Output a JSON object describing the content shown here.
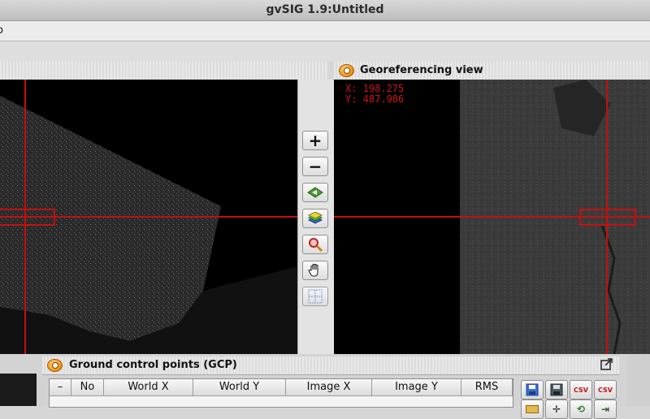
{
  "window": {
    "title": "gvSIG 1.9:Untitled"
  },
  "menubar": {
    "partial_menu_label": "o"
  },
  "left_panel": {
    "header_title": ""
  },
  "georef_view": {
    "title": "Georeferencing view",
    "coord_x": "X: 198.275",
    "coord_y": "Y: 487.986"
  },
  "toolbar": {
    "zoom_in_label": "+",
    "zoom_out_label": "−",
    "full_extent_icon": "full-extent-icon",
    "layers_icon": "layers-icon",
    "zoom_tool_icon": "magnifier-icon",
    "pan_icon": "hand-icon",
    "grid_icon": "grid-icon"
  },
  "gcp_panel": {
    "title": "Ground control points (GCP)",
    "columns": [
      "–",
      "No",
      "World X",
      "World Y",
      "Image X",
      "Image Y",
      "RMS"
    ],
    "rows": []
  },
  "gcp_actions": [
    {
      "icon": "save-icon",
      "label": ""
    },
    {
      "icon": "save-as-icon",
      "label": ""
    },
    {
      "icon": "export-csv-icon",
      "label": "CSV"
    },
    {
      "icon": "import-csv-icon",
      "label": "CSV"
    },
    {
      "icon": "folder-icon",
      "label": ""
    },
    {
      "icon": "center-icon",
      "label": ""
    },
    {
      "icon": "refresh-icon",
      "label": ""
    },
    {
      "icon": "exit-icon",
      "label": ""
    }
  ],
  "colors": {
    "crosshair": "#c31010",
    "coord_text": "#d31414",
    "accent_orange": "#f39a1c"
  }
}
